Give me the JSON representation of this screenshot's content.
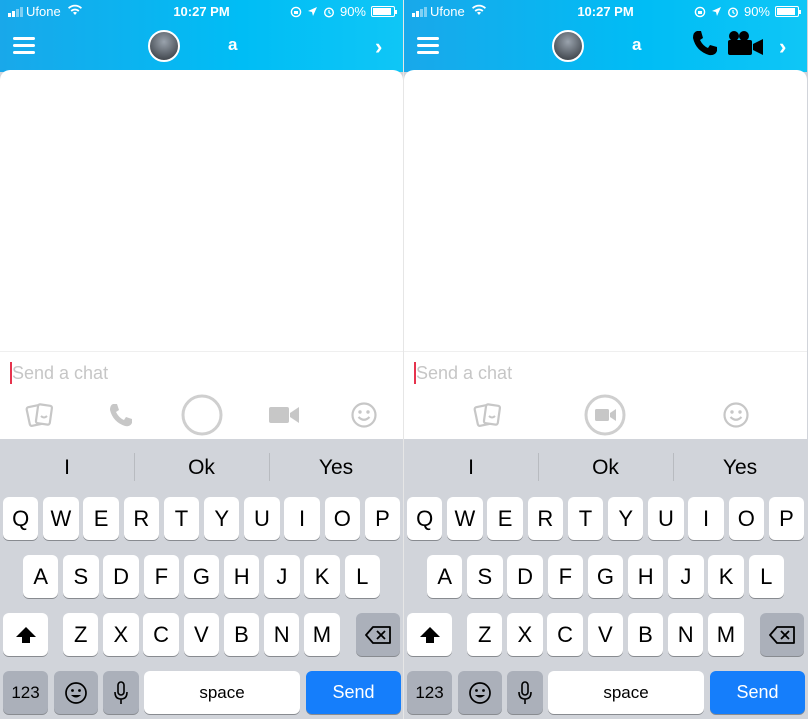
{
  "status_bar": {
    "carrier": "Ufone",
    "time": "10:27 PM",
    "battery": "90%",
    "battery_level": 0.9
  },
  "header": {
    "contact_name": "a",
    "forward_glyph": "›"
  },
  "chat_input": {
    "placeholder": "Send a chat"
  },
  "suggestions": [
    "I",
    "Ok",
    "Yes"
  ],
  "keyboard": {
    "row1": [
      "Q",
      "W",
      "E",
      "R",
      "T",
      "Y",
      "U",
      "I",
      "O",
      "P"
    ],
    "row2": [
      "A",
      "S",
      "D",
      "F",
      "G",
      "H",
      "J",
      "K",
      "L"
    ],
    "row3": [
      "Z",
      "X",
      "C",
      "V",
      "B",
      "N",
      "M"
    ],
    "numbers_label": "123",
    "space_label": "space",
    "send_label": "Send"
  },
  "icons": {
    "left_actions": [
      "stickers-icon",
      "phone-icon",
      "camera-shutter-icon",
      "video-icon",
      "emoji-icon"
    ],
    "right_actions": [
      "stickers-icon",
      "video-call-icon",
      "emoji-icon"
    ],
    "right_header": [
      "phone-call-icon",
      "video-call-icon"
    ]
  },
  "colors": {
    "header_blue": "#0fadf0",
    "send_blue": "#157efb",
    "cursor_red": "#e6334d"
  }
}
